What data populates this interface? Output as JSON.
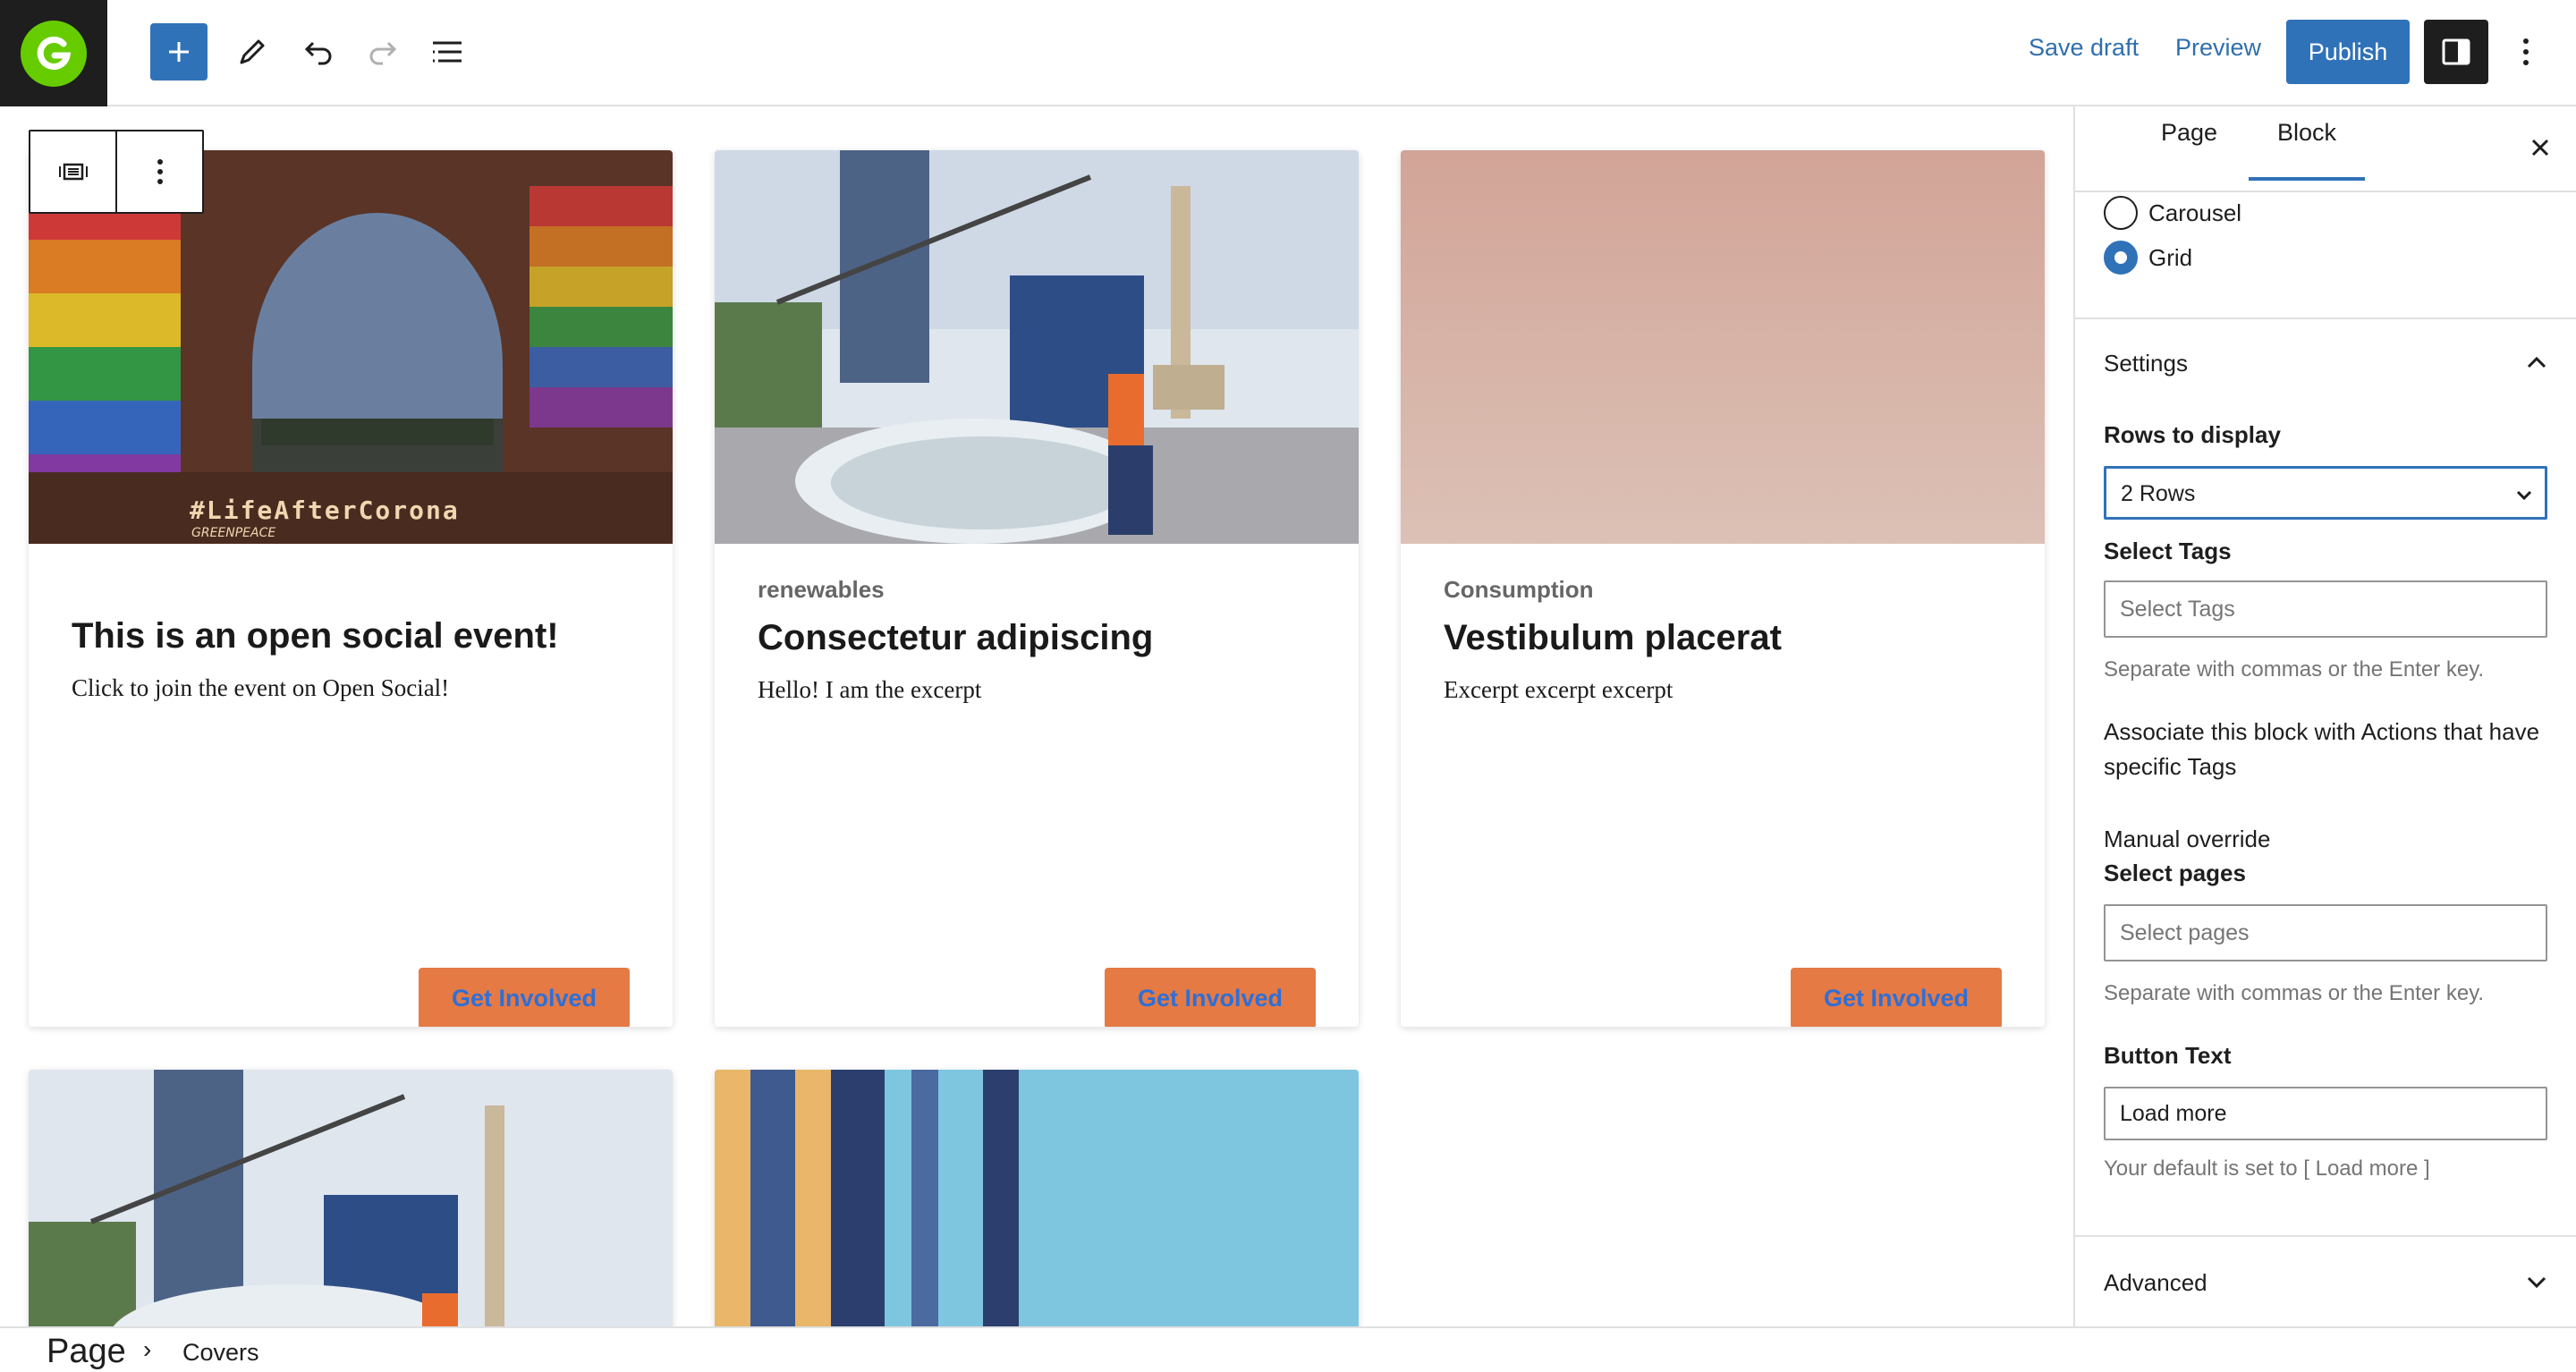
{
  "topbar": {
    "save_draft": "Save draft",
    "preview": "Preview",
    "publish": "Publish",
    "accent": "#3072b8"
  },
  "cards": [
    {
      "tag": "",
      "title": "This is an open social event!",
      "excerpt": "Click to join the event on Open Social!",
      "button": "Get Involved",
      "image_caption": "#LifeAfterCorona",
      "image_sub": "GREENPEACE"
    },
    {
      "tag": "renewables",
      "title": "Consectetur adipiscing",
      "excerpt": "Hello! I am the excerpt",
      "button": "Get Involved"
    },
    {
      "tag": "Consumption",
      "title": "Vestibulum placerat",
      "excerpt": "Excerpt excerpt excerpt",
      "button": "Get Involved"
    }
  ],
  "sidebar": {
    "tabs": [
      "Page",
      "Block"
    ],
    "active_tab": "Block",
    "layout_options": [
      "Carousel",
      "Grid"
    ],
    "layout_selected": "Grid",
    "settings_title": "Settings",
    "rows_label": "Rows to display",
    "rows_value": "2 Rows",
    "tags_label": "Select Tags",
    "tags_placeholder": "Select Tags",
    "tags_help": "Separate with commas or the Enter key.",
    "associate_text": "Associate this block with Actions that have specific Tags",
    "manual_override": "Manual override",
    "pages_label": "Select pages",
    "pages_placeholder": "Select pages",
    "pages_help": "Separate with commas or the Enter key.",
    "button_text_label": "Button Text",
    "button_text_value": "Load more",
    "button_text_help": "Your default is set to [ Load more ]",
    "advanced_title": "Advanced"
  },
  "breadcrumb": {
    "page": "Page",
    "current": "Covers"
  }
}
